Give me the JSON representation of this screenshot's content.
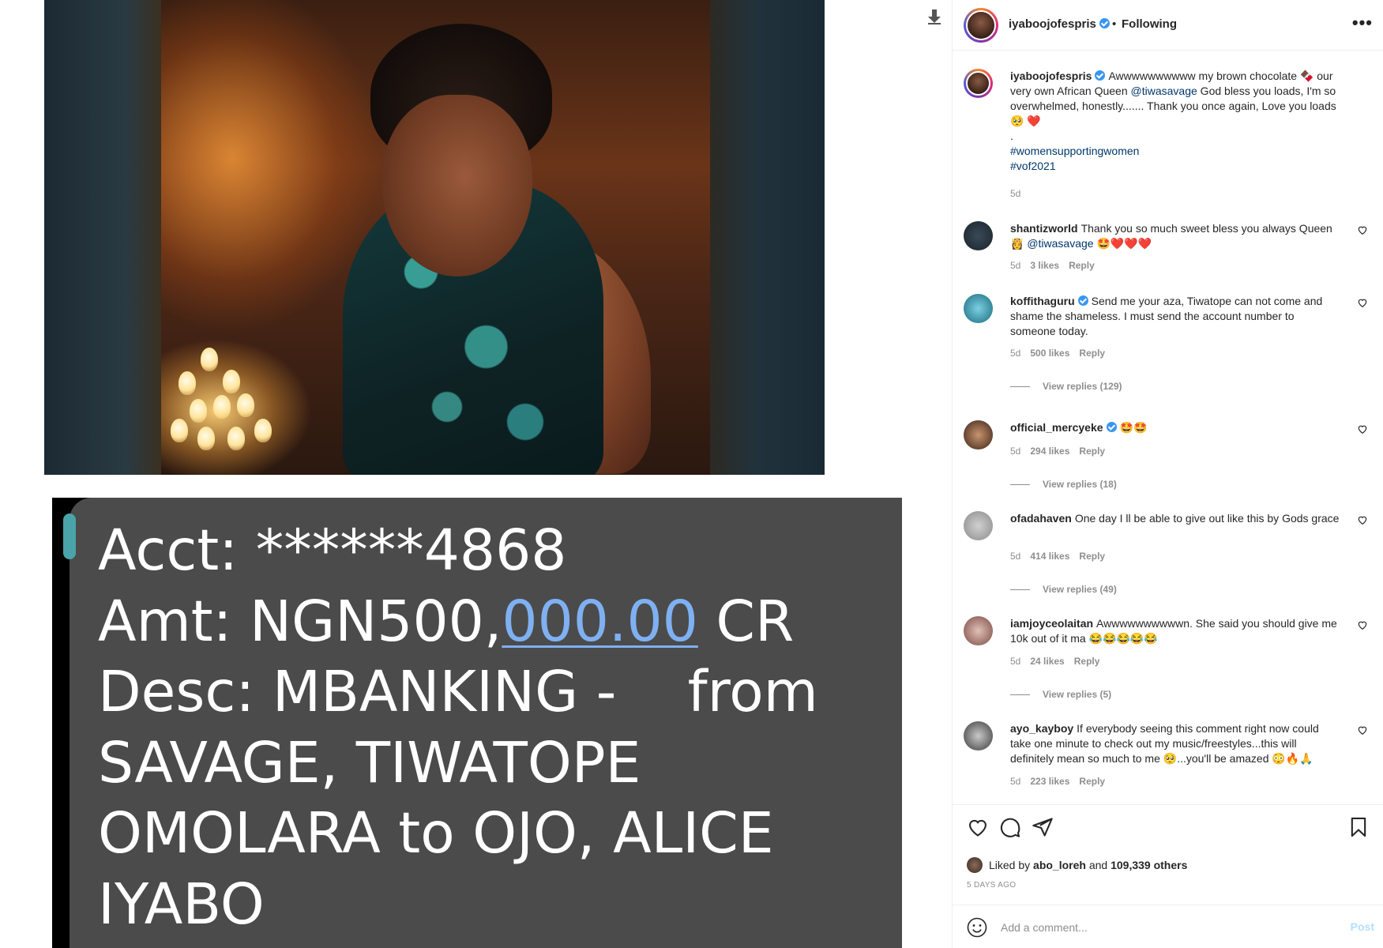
{
  "receipt": {
    "line1": "Acct: ******4868",
    "line2_prefix": "Amt: NGN500,",
    "line2_link": "000.00",
    "line2_suffix": " CR",
    "line3": "Desc: MBANKING -    from",
    "line4": "SAVAGE, TIWATOPE",
    "line5": "OMOLARA to OJO, ALICE",
    "line6": "IYABO"
  },
  "header": {
    "username": "iyaboojofespris",
    "separator": "•",
    "follow_status": "Following",
    "more": "•••"
  },
  "caption": {
    "username": "iyaboojofespris",
    "text": "Awwwwwwwwww my brown chocolate 🍫 our very own African Queen ",
    "mention": "@tiwasavage",
    "text2": " God bless you loads, I'm so overwhelmed, honestly....... Thank you once again, Love you loads",
    "emojis": "🥺 ❤️",
    "dot": ".",
    "hashtag1": "#womensupportingwomen",
    "hashtag2": "#vof2021",
    "time": "5d"
  },
  "comments": [
    {
      "username": "shantizworld",
      "text": "Thank you so much sweet bless you always Queen 👸",
      "mention": "@tiwasavage",
      "emojis": "🤩❤️❤️❤️",
      "time": "5d",
      "likes": "3 likes",
      "reply": "Reply"
    },
    {
      "username": "koffithaguru",
      "text": "Send me your aza, Tiwatope can not come and shame the shameless. I must send the account number to someone today.",
      "time": "5d",
      "likes": "500 likes",
      "reply": "Reply",
      "view_replies": "View replies (129)"
    },
    {
      "username": "official_mercyeke",
      "emojis": "🤩🤩",
      "time": "5d",
      "likes": "294 likes",
      "reply": "Reply",
      "view_replies": "View replies (18)"
    },
    {
      "username": "ofadahaven",
      "text": "One day I ll be able to give out like this by Gods grace",
      "time": "5d",
      "likes": "414 likes",
      "reply": "Reply",
      "view_replies": "View replies (49)"
    },
    {
      "username": "iamjoyceolaitan",
      "text": "Awwwwwwwwwwn. She said you should give me 10k out of it ma",
      "emojis": "😂😂😂😂😂",
      "time": "5d",
      "likes": "24 likes",
      "reply": "Reply",
      "view_replies": "View replies (5)"
    },
    {
      "username": "ayo_kayboy",
      "text": "If everybody seeing this comment right now could take one minute to check out my music/freestyles...this will definitely mean so much to me 🥺...you'll be amazed",
      "emojis": "😳🔥🙏",
      "time": "5d",
      "likes": "223 likes",
      "reply": "Reply"
    }
  ],
  "likes": {
    "prefix": "Liked by ",
    "user": "abo_loreh",
    "middle": " and ",
    "others": "109,339 others"
  },
  "time_ago": "5 DAYS AGO",
  "add_comment": {
    "placeholder": "Add a comment...",
    "post_label": "Post"
  },
  "colors": {
    "link": "#00376b",
    "muted": "#8e8e8e",
    "verified": "#3897f0",
    "post_disabled": "#b2dffc"
  },
  "icons": [
    "save-arrow-icon",
    "verified-badge-icon",
    "more-options-icon",
    "heart-icon",
    "comment-icon",
    "share-icon",
    "bookmark-icon",
    "smile-icon"
  ]
}
